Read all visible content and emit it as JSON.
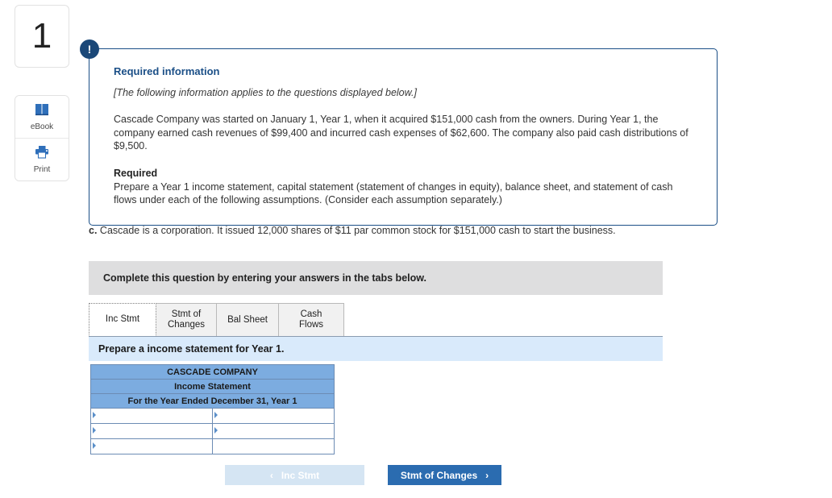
{
  "left_rail": {
    "question_number": "1",
    "tools": [
      {
        "icon": "book-icon",
        "label": "eBook"
      },
      {
        "icon": "printer-icon",
        "label": "Print"
      }
    ]
  },
  "info_panel": {
    "alert_icon": "exclamation-icon",
    "heading": "Required information",
    "applies_note": "[The following information applies to the questions displayed below.]",
    "scenario": "Cascade Company was started on January 1, Year 1, when it acquired $151,000 cash from the owners. During Year 1, the company earned cash revenues of $99,400 and incurred cash expenses of $62,600. The company also paid cash distributions of $9,500.",
    "required_heading": "Required",
    "required_text": "Prepare a Year 1 income statement, capital statement (statement of changes in equity), balance sheet, and statement of cash flows under each of the following assumptions. (Consider each assumption separately.)"
  },
  "part_c": {
    "letter": "c.",
    "text": " Cascade is a corporation. It issued 12,000 shares of $11 par common stock for $151,000 cash to start the business."
  },
  "complete_banner": {
    "text": "Complete this question by entering your answers in the tabs below."
  },
  "tabs": [
    {
      "label": "Inc Stmt",
      "active": true
    },
    {
      "label": "Stmt of Changes",
      "active": false
    },
    {
      "label": "Bal Sheet",
      "active": false
    },
    {
      "label": "Cash Flows",
      "active": false
    }
  ],
  "instruction": {
    "text": "Prepare a income statement for Year 1."
  },
  "statement": {
    "company_name": "CASCADE COMPANY",
    "statement_title": "Income Statement",
    "period": "For the Year Ended December 31, Year 1",
    "rows": [
      {
        "label": "",
        "value": ""
      },
      {
        "label": "",
        "value": ""
      },
      {
        "label": "",
        "value": ""
      }
    ]
  },
  "nav": {
    "prev_label": "Inc Stmt",
    "prev_chevron": "‹",
    "next_label": "Stmt of Changes",
    "next_chevron": "›"
  },
  "colors": {
    "panel_border": "#1b4f87",
    "heading_blue": "#1b4f87",
    "table_header_blue": "#7cace0",
    "instruction_blue": "#d9eafb",
    "banner_gray": "#dededf",
    "next_button_blue": "#2b6cb0",
    "prev_button_blue": "#d5e5f3"
  }
}
